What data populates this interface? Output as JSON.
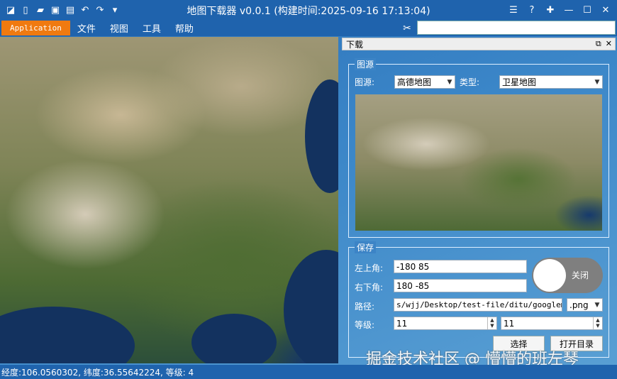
{
  "window": {
    "title": "地图下载器 v0.0.1 (构建时间:2025-09-16 17:13:04)"
  },
  "menubar": {
    "app_button": "Application",
    "items": [
      "文件",
      "视图",
      "工具",
      "帮助"
    ]
  },
  "panel": {
    "title": "下载",
    "source_group": {
      "legend": "图源",
      "source_label": "图源:",
      "source_value": "高德地图",
      "type_label": "类型:",
      "type_value": "卫星地图"
    },
    "save_group": {
      "legend": "保存",
      "top_left_label": "左上角:",
      "top_left_value": "-180 85",
      "bottom_right_label": "右下角:",
      "bottom_right_value": "180 -85",
      "path_label": "路径:",
      "path_value": "s/wjj/Desktop/test-file/ditu/googlemap",
      "format_value": ".png",
      "level_label": "等级:",
      "level_min": "11",
      "level_max": "11",
      "select_button": "选择",
      "open_dir_button": "打开目录",
      "toggle_label": "关闭"
    }
  },
  "watermark": "掘金技术社区 @ 懵懵的班左琴",
  "status": "经度:106.0560302, 纬度:36.55642224, 等级: 4"
}
